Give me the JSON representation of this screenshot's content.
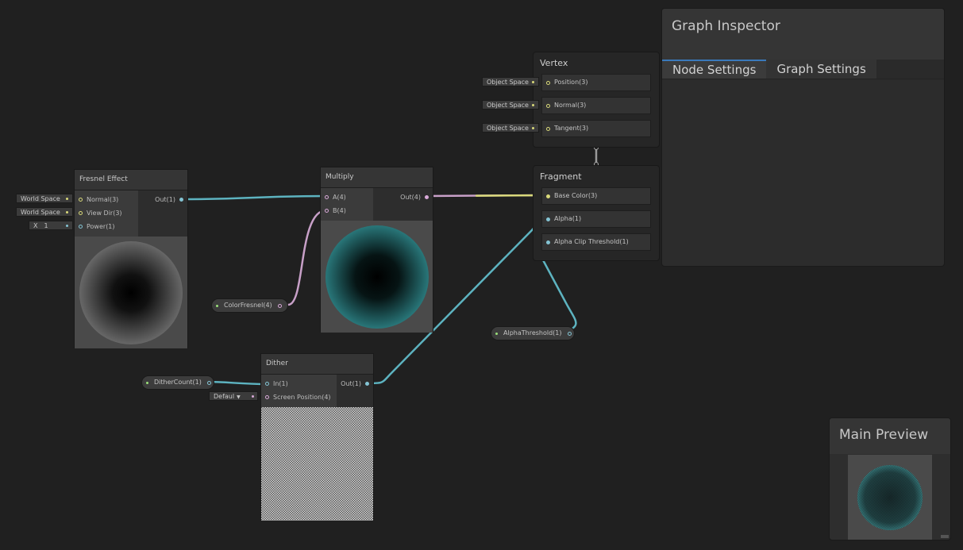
{
  "colors": {
    "vec3": "#d9d97a",
    "vec1": "#84c4d4",
    "vec4": "#d8a9d8",
    "wire_vec1": "#5db3c0",
    "wire_vec4": "#c8a0c8"
  },
  "nodes": {
    "fresnel": {
      "title": "Fresnel Effect",
      "inputs": [
        "Normal(3)",
        "View Dir(3)",
        "Power(1)"
      ],
      "outputs": [
        "Out(1)"
      ],
      "fields": {
        "normal": "World Space",
        "view_dir": "World Space",
        "power_label": "X",
        "power_value": "1"
      }
    },
    "multiply": {
      "title": "Multiply",
      "inputs": [
        "A(4)",
        "B(4)"
      ],
      "outputs": [
        "Out(4)"
      ]
    },
    "dither": {
      "title": "Dither",
      "inputs": [
        "In(1)",
        "Screen Position(4)"
      ],
      "outputs": [
        "Out(1)"
      ],
      "fields": {
        "screen_position": "Defaul"
      }
    }
  },
  "properties": {
    "color_fresnel": "ColorFresnel(4)",
    "dither_count": "DitherCount(1)",
    "alpha_threshold": "AlphaThreshold(1)"
  },
  "vertex": {
    "title": "Vertex",
    "blocks": [
      "Position(3)",
      "Normal(3)",
      "Tangent(3)"
    ],
    "spaces": [
      "Object Space",
      "Object Space",
      "Object Space"
    ]
  },
  "fragment": {
    "title": "Fragment",
    "blocks": [
      "Base Color(3)",
      "Alpha(1)",
      "Alpha Clip Threshold(1)"
    ]
  },
  "inspector": {
    "title": "Graph Inspector",
    "tabs": [
      "Node Settings",
      "Graph Settings"
    ],
    "active_tab": "Node Settings"
  },
  "main_preview": {
    "title": "Main Preview"
  }
}
